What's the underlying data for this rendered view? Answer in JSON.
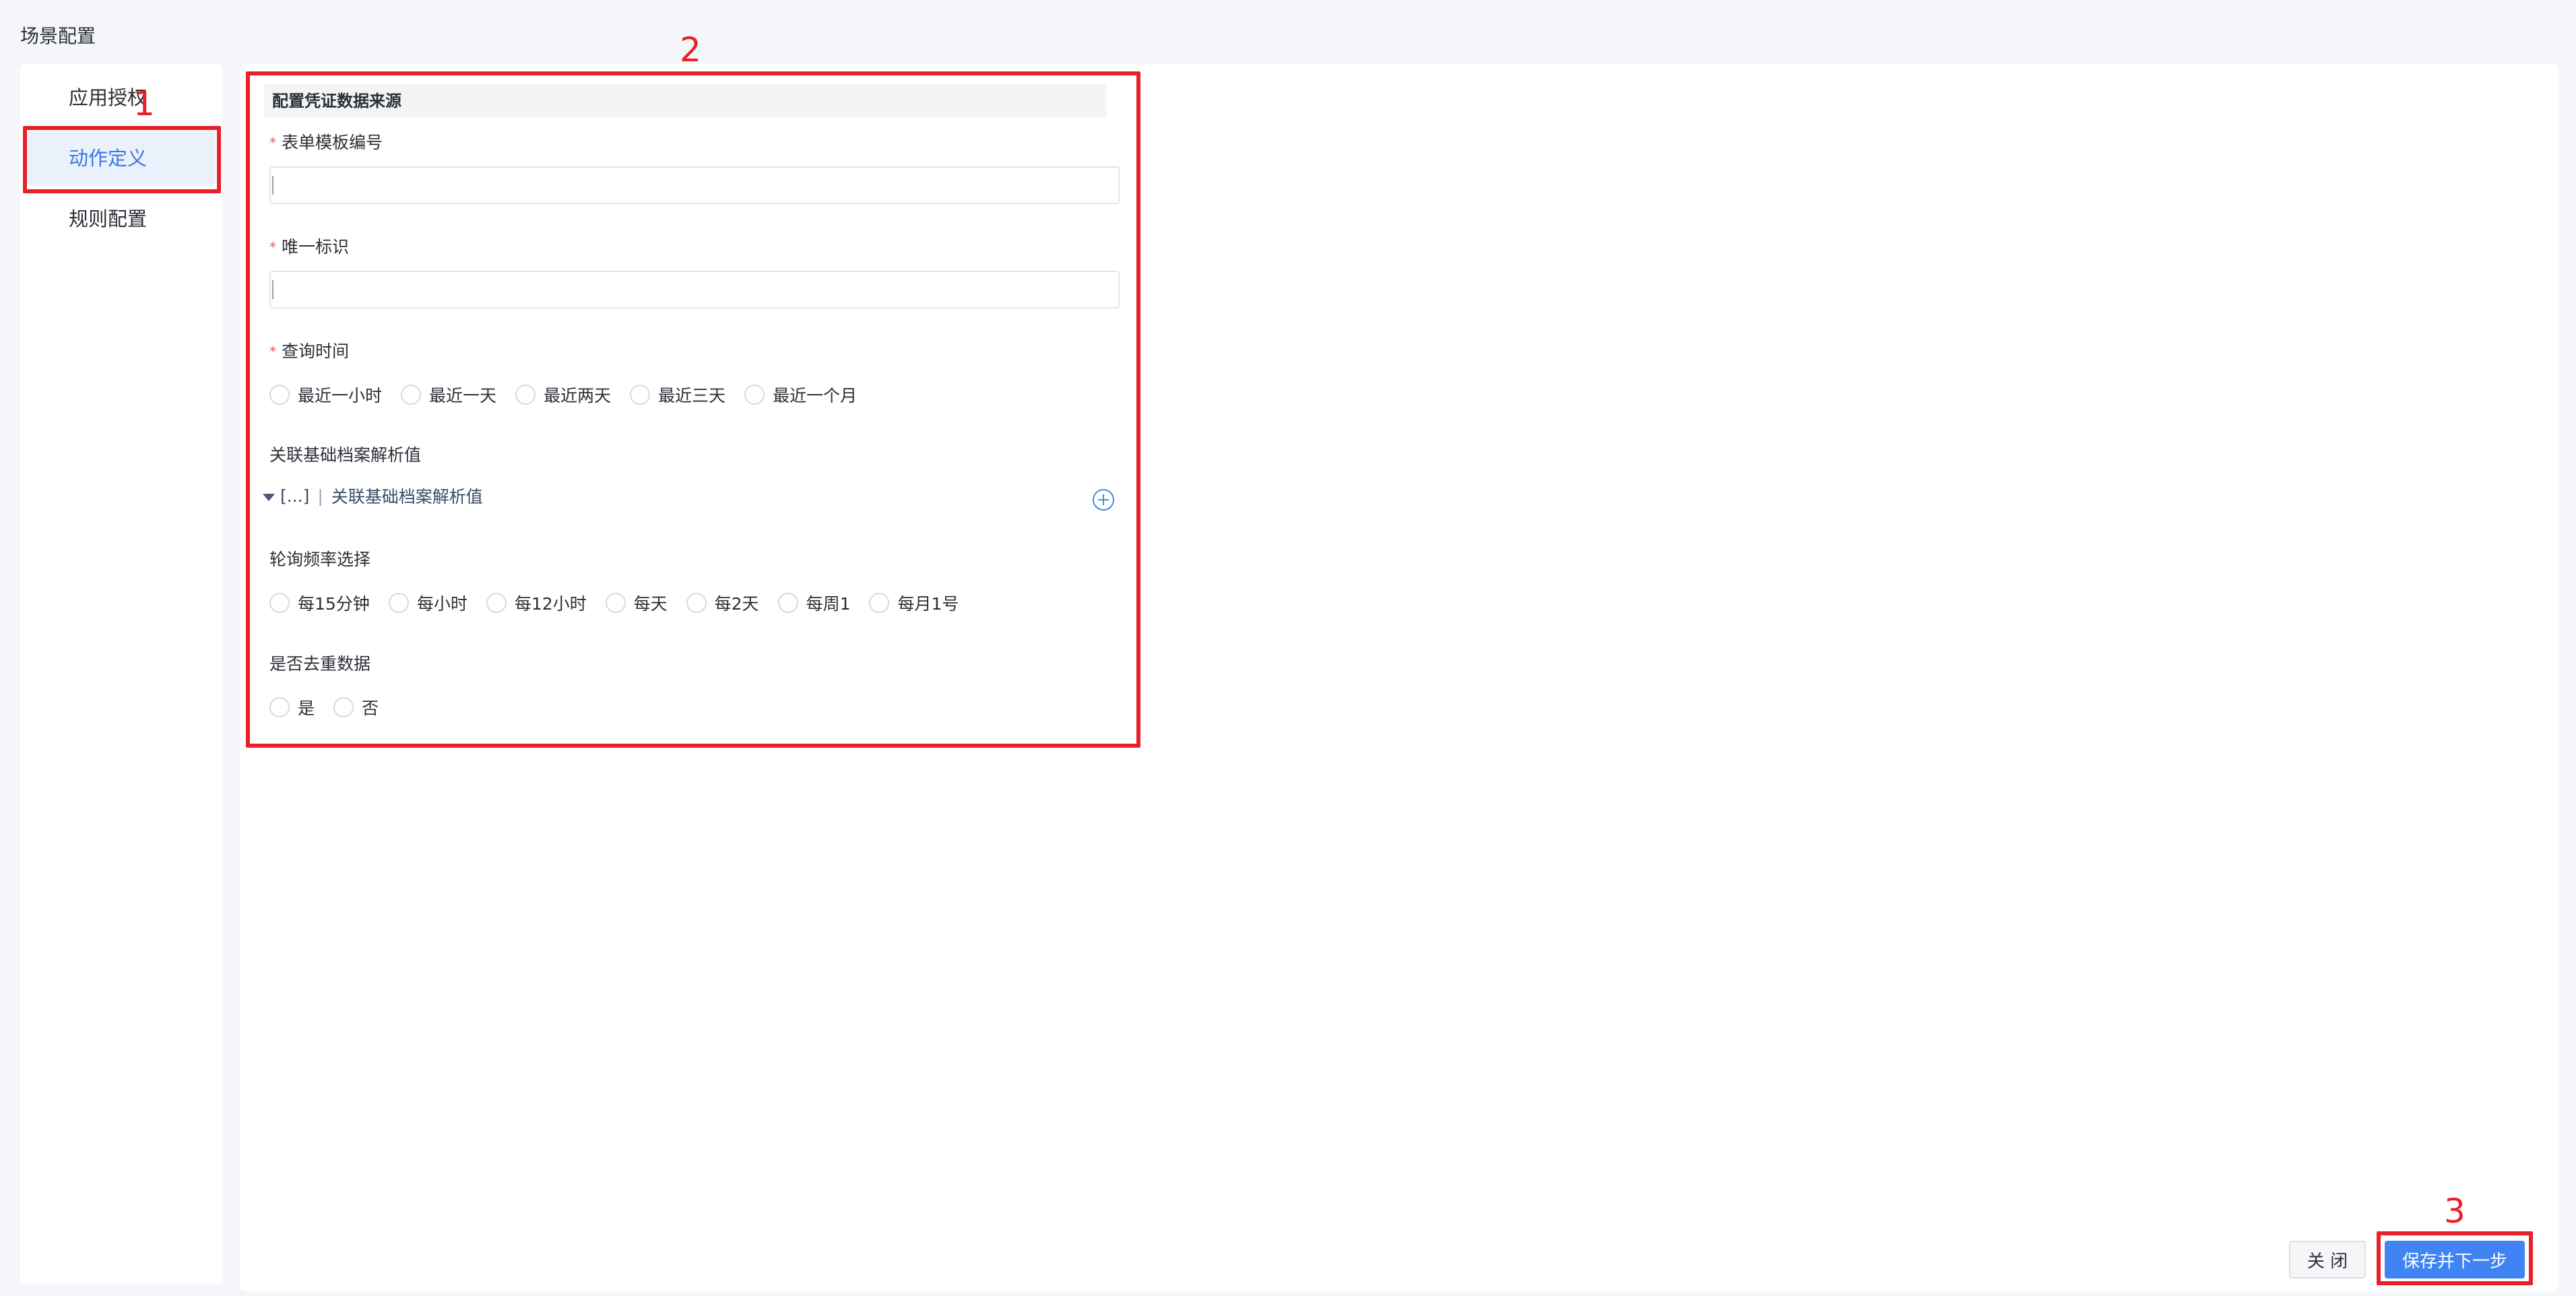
{
  "page_title": "场景配置",
  "sidebar": {
    "items": [
      {
        "label": "应用授权",
        "active": false
      },
      {
        "label": "动作定义",
        "active": true
      },
      {
        "label": "规则配置",
        "active": false
      }
    ]
  },
  "form": {
    "section_title": "配置凭证数据来源",
    "fields": {
      "template_code": {
        "label": "表单模板编号",
        "required": true,
        "value": "",
        "placeholder": ""
      },
      "unique_id": {
        "label": "唯一标识",
        "required": true,
        "value": "",
        "placeholder": ""
      },
      "query_time": {
        "label": "查询时间",
        "required": true,
        "options": [
          "最近一小时",
          "最近一天",
          "最近两天",
          "最近三天",
          "最近一个月"
        ]
      },
      "assoc": {
        "label": "关联基础档案解析值",
        "ellipsis": "[...]",
        "separator": "|",
        "item_label": "关联基础档案解析值"
      },
      "poll_freq": {
        "label": "轮询频率选择",
        "options": [
          "每15分钟",
          "每小时",
          "每12小时",
          "每天",
          "每2天",
          "每周1",
          "每月1号"
        ]
      },
      "dedupe": {
        "label": "是否去重数据",
        "options": [
          "是",
          "否"
        ]
      }
    }
  },
  "buttons": {
    "close": "关 闭",
    "save_next": "保存并下一步"
  },
  "annotations": [
    "1",
    "2",
    "3"
  ],
  "colors": {
    "accent": "#3f84f2",
    "annotation": "#e8202a",
    "required": "#f0555a"
  }
}
